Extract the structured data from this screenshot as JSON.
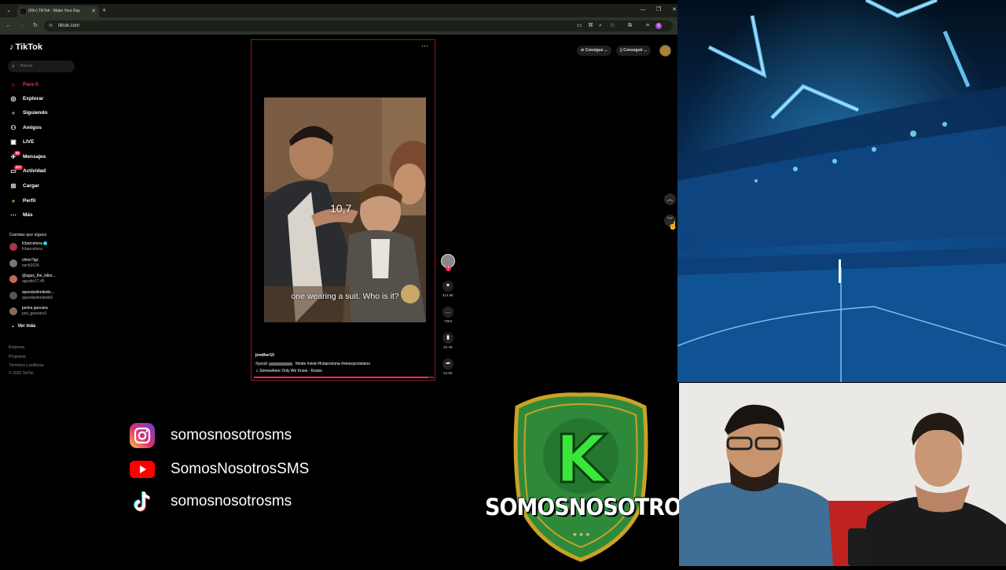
{
  "browser": {
    "tab_title": "(99+) TikTok - Make Your Day",
    "new_tab": "+",
    "url": "tiktok.com",
    "profile_initial": "S"
  },
  "tiktok": {
    "logo": "TikTok",
    "search_placeholder": "Buscar",
    "nav": [
      {
        "label": "Para ti",
        "icon": "home-icon",
        "glyph": "⌂"
      },
      {
        "label": "Explorar",
        "icon": "compass-icon",
        "glyph": "◎"
      },
      {
        "label": "Siguiendo",
        "icon": "following-avatar-icon",
        "glyph": "●"
      },
      {
        "label": "Amigos",
        "icon": "friends-icon",
        "glyph": "⚇"
      },
      {
        "label": "LIVE",
        "icon": "live-icon",
        "glyph": "▣"
      },
      {
        "label": "Mensajes",
        "icon": "messages-icon",
        "glyph": "✈",
        "badge": "99"
      },
      {
        "label": "Actividad",
        "icon": "activity-icon",
        "glyph": "▭",
        "badge": "99+"
      },
      {
        "label": "Cargar",
        "icon": "upload-icon",
        "glyph": "⊞"
      },
      {
        "label": "Perfil",
        "icon": "profile-avatar-icon",
        "glyph": "●"
      },
      {
        "label": "Más",
        "icon": "more-icon",
        "glyph": "⋯"
      }
    ],
    "following_title": "Cuentas que sigues",
    "accounts": [
      {
        "name": "fcbarcelona",
        "handle": "fcbarcelona",
        "verified": true
      },
      {
        "name": "chino?igc",
        "handle": "sech2024",
        "verified": false
      },
      {
        "name": "@agus_the_killer...",
        "handle": "agustin17.45",
        "verified": false
      },
      {
        "name": "speedunlimitedo...",
        "handle": "speedunlimitedo0",
        "verified": false
      },
      {
        "name": "janina guevara",
        "handle": "jani_guevara1",
        "verified": false
      }
    ],
    "see_more": "Ver más",
    "footer": [
      "Empresa",
      "Programa",
      "Términos y políticas",
      "© 2025 TikTok"
    ],
    "top_buttons": [
      "Consigue ...",
      "Conseguir ..."
    ],
    "video": {
      "counter": "10,7",
      "caption": "one wearing a suit. Who is it?",
      "author": "jondher10",
      "hashtags_prefix": "#parati",
      "hashtags": "#triste #viral #fcbarcelona #messiycristiano",
      "music": "♫ Somewhere Only We Know - Keane",
      "progress": 0.97
    },
    "actions": {
      "likes": "414.8K",
      "comments": "7304",
      "saves": "22.4K",
      "shares": "54.5K"
    }
  },
  "social": [
    {
      "platform": "instagram",
      "icon": "instagram-icon",
      "handle": "somosnosotrosms"
    },
    {
      "platform": "youtube",
      "icon": "youtube-icon",
      "handle": "SomosNosotrosSMS"
    },
    {
      "platform": "tiktok",
      "icon": "tiktok-icon",
      "handle": "somosnosotrosms"
    }
  ],
  "logo": {
    "letter": "K",
    "text": "SOMOSNOSOTROS",
    "stars": "★ ★ ★"
  },
  "colors": {
    "tiktok_red": "#fe2c55",
    "logo_green": "#2e8a3a",
    "logo_gold": "#c9a227",
    "k_green": "#39e639"
  }
}
